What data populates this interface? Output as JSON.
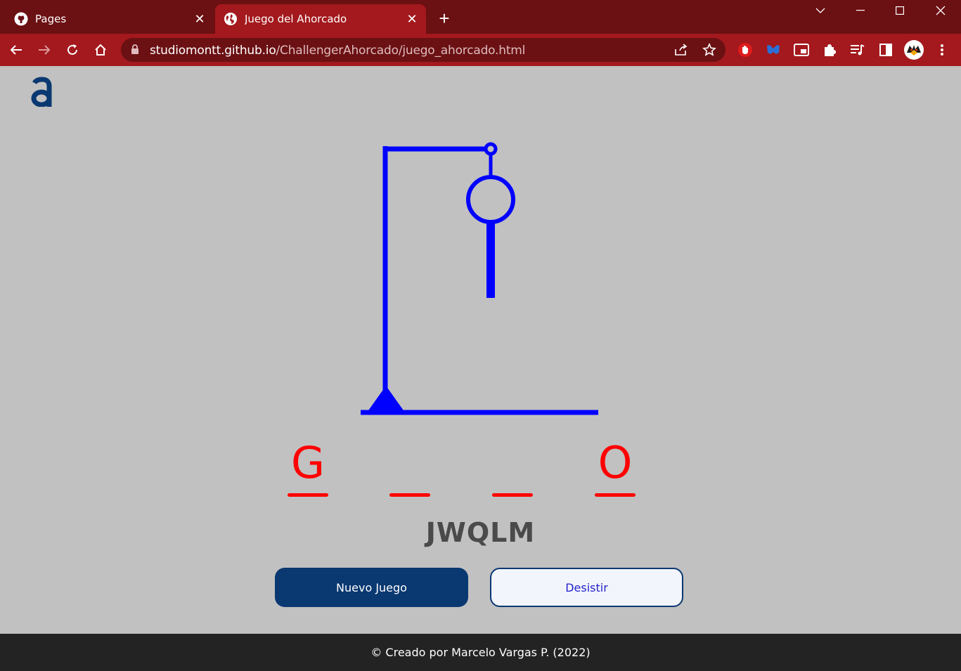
{
  "browser": {
    "tabs": [
      {
        "title": "Pages",
        "icon": "github-icon"
      },
      {
        "title": "Juego del Ahorcado",
        "icon": "globe-icon",
        "active": true
      }
    ],
    "url_host": "studiomontt.github.io",
    "url_path": "/ChallengerAhorcado/juego_ahorcado.html"
  },
  "game": {
    "slots": [
      "G",
      "",
      "",
      "O"
    ],
    "wrong_letters": "JWQLM"
  },
  "buttons": {
    "new_game": "Nuevo Juego",
    "give_up": "Desistir"
  },
  "footer": {
    "text": "© Creado por Marcelo Vargas P. (2022)"
  },
  "colors": {
    "accent": "#0a3871",
    "hangman": "#0000ff",
    "letters": "#ff0000",
    "chrome": "#a3191d"
  }
}
